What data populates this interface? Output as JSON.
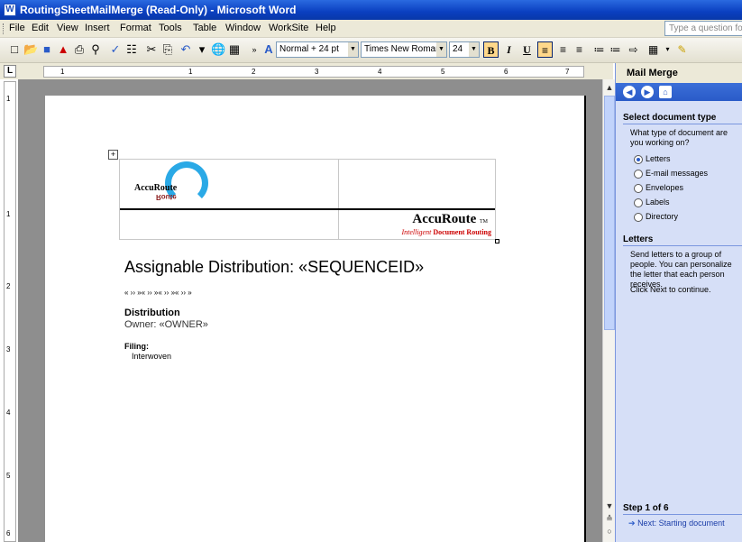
{
  "window": {
    "title": "RoutingSheetMailMerge (Read-Only) - Microsoft Word",
    "icon": "word-icon"
  },
  "menu": {
    "items": [
      "File",
      "Edit",
      "View",
      "Insert",
      "Format",
      "Tools",
      "Table",
      "Window",
      "WorkSite",
      "Help"
    ],
    "ask_placeholder": "Type a question for"
  },
  "toolbar": {
    "style": "Normal + 24 pt",
    "font": "Times New Roman",
    "size": "24",
    "bold": "B",
    "italic": "I",
    "underline": "U"
  },
  "ruler": {
    "h_numbers": [
      "1",
      "1",
      "2",
      "3",
      "4",
      "5",
      "6",
      "7"
    ],
    "v_numbers": [
      "1",
      "1",
      "2",
      "3",
      "4",
      "5",
      "6"
    ]
  },
  "taskpane": {
    "title": "Mail Merge",
    "section1_heading": "Select document type",
    "section1_question": "What type of document are you working on?",
    "options": [
      "Letters",
      "E-mail messages",
      "Envelopes",
      "Labels",
      "Directory"
    ],
    "selected": "Letters",
    "section2_heading": "Letters",
    "section2_text": "Send letters to a group of people. You can personalize the letter that each person receives.",
    "section2_next": "Click Next to continue.",
    "step": "Step 1 of 6",
    "next_link": "Next: Starting document"
  },
  "document": {
    "logo_text": "AccuRoute",
    "logo_mirror": "Route",
    "brand": "AccuRoute",
    "brand_tm": "TM",
    "tagline_prefix": "Intelligent",
    "tagline_bold": "Document Routing",
    "heading": "Assignable Distribution: «SEQUENCEID»",
    "field_line": "« ›› »« ›› »« ›› »« ›› »",
    "dist_label": "Distribution",
    "owner_line": "Owner: «OWNER»",
    "filing_label": "Filing:",
    "filing_value": "Interwoven"
  }
}
